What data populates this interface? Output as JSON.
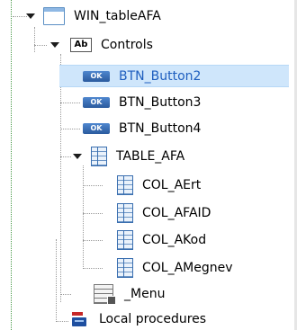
{
  "tree": {
    "nodes": [
      {
        "id": "win",
        "label": "WIN_tableAFA",
        "icon": "window-icon",
        "expanded": true
      },
      {
        "id": "controls",
        "label": "Controls",
        "icon": "ab-control-icon",
        "expanded": true
      },
      {
        "id": "btn2",
        "label": "BTN_Button2",
        "icon": "ok-button-icon",
        "selected": true
      },
      {
        "id": "btn3",
        "label": "BTN_Button3",
        "icon": "ok-button-icon"
      },
      {
        "id": "btn4",
        "label": "BTN_Button4",
        "icon": "ok-button-icon"
      },
      {
        "id": "table",
        "label": "TABLE_AFA",
        "icon": "table-icon",
        "expanded": true
      },
      {
        "id": "col1",
        "label": "COL_AErt",
        "icon": "column-icon"
      },
      {
        "id": "col2",
        "label": "COL_AFAID",
        "icon": "column-icon"
      },
      {
        "id": "col3",
        "label": "COL_AKod",
        "icon": "column-icon"
      },
      {
        "id": "col4",
        "label": "COL_AMegnev",
        "icon": "column-icon"
      },
      {
        "id": "menu",
        "label": "_Menu",
        "icon": "menu-icon"
      },
      {
        "id": "proc",
        "label": "Local procedures",
        "icon": "procedures-icon"
      }
    ],
    "ab_glyph": "Ab",
    "ok_glyph": "OK"
  },
  "colors": {
    "selection": "#cfe6fb",
    "label_selected": "#1f5fbf",
    "gutter_line": "#4a9a4a",
    "connector": "#9a9a9a"
  }
}
